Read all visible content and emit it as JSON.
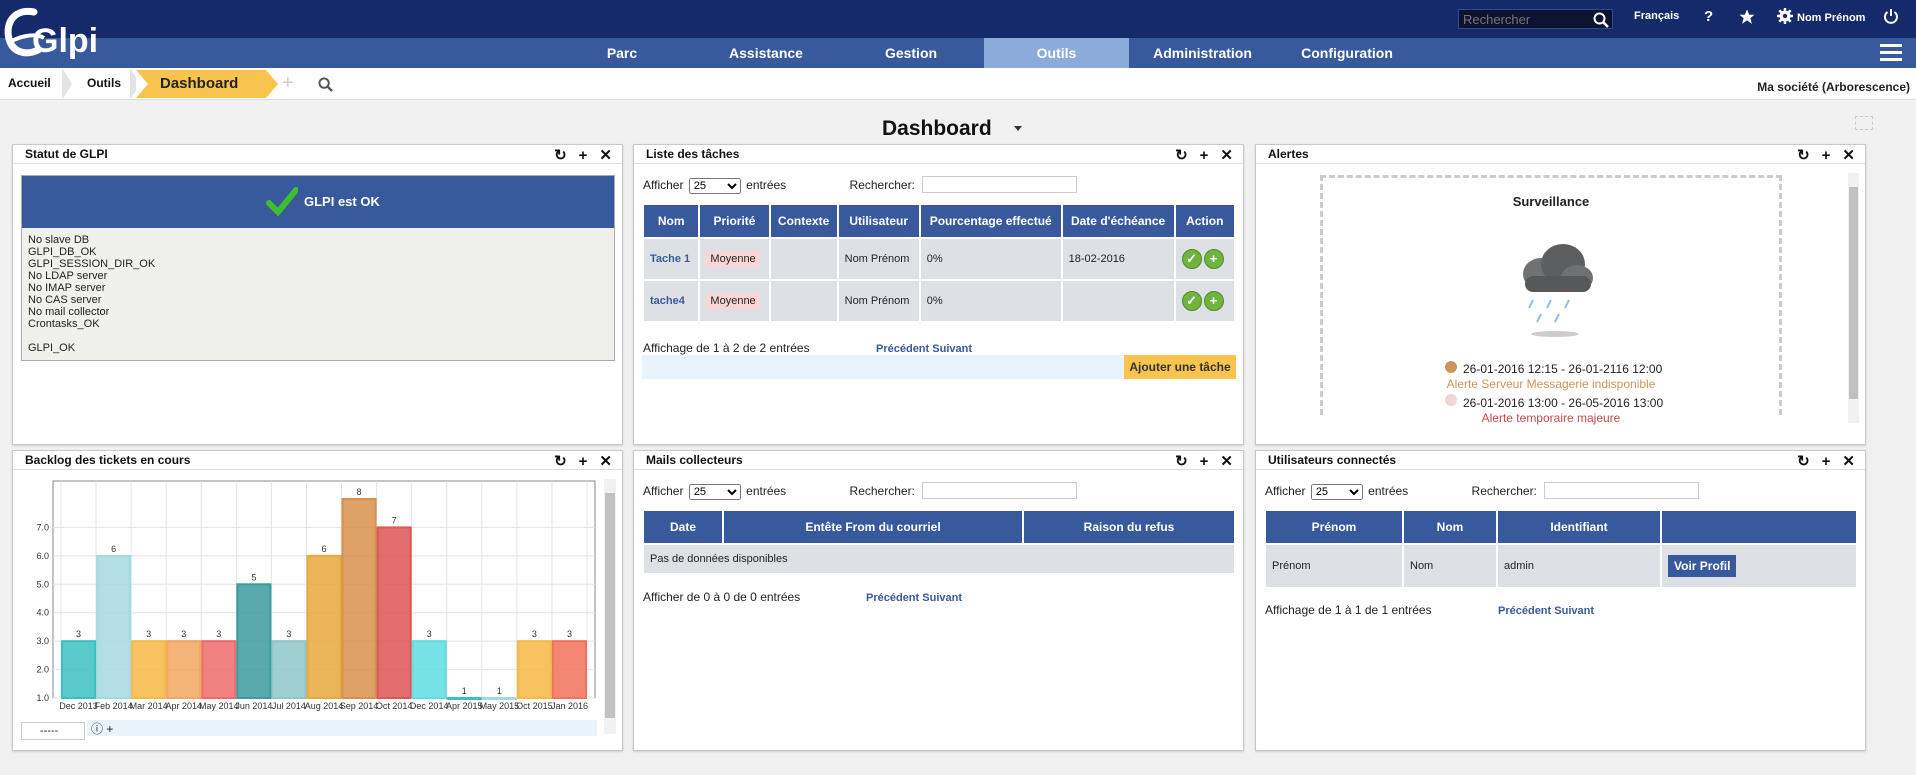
{
  "header": {
    "logo_text": "Glpi",
    "search_placeholder": "Rechercher",
    "language": "Français",
    "help_icon": "?",
    "user_name": "Nom Prénom"
  },
  "nav": {
    "items": [
      {
        "label": "Parc"
      },
      {
        "label": "Assistance"
      },
      {
        "label": "Gestion"
      },
      {
        "label": "Outils",
        "active": true
      },
      {
        "label": "Administration"
      },
      {
        "label": "Configuration"
      }
    ]
  },
  "breadcrumb": {
    "items": [
      "Accueil",
      "Outils"
    ],
    "active": "Dashboard",
    "add_icon": "+",
    "entity": "Ma société (Arborescence)"
  },
  "dashboard": {
    "title": "Dashboard"
  },
  "panel_icons": {
    "refresh": "↻",
    "add": "+",
    "close": "✕"
  },
  "status_panel": {
    "title": "Statut de GLPI",
    "banner": "GLPI est OK",
    "lines": [
      "No slave DB",
      "GLPI_DB_OK",
      "GLPI_SESSION_DIR_OK",
      "No LDAP server",
      "No IMAP server",
      "No CAS server",
      "No mail collector",
      "Crontasks_OK",
      "",
      "GLPI_OK"
    ]
  },
  "tasks_panel": {
    "title": "Liste des tâches",
    "show_label": "Afficher",
    "page_size": "25",
    "entries_label": "entrées",
    "search_label": "Rechercher:",
    "columns": [
      "Nom",
      "Priorité",
      "Contexte",
      "Utilisateur",
      "Pourcentage effectué",
      "Date d'échéance",
      "Action"
    ],
    "rows": [
      {
        "nom": "Tache 1",
        "priorite": "Moyenne",
        "contexte": "",
        "utilisateur": "Nom Prénom",
        "pourcentage": "0%",
        "echeance": "18-02-2016"
      },
      {
        "nom": "tache4",
        "priorite": "Moyenne",
        "contexte": "",
        "utilisateur": "Nom Prénom",
        "pourcentage": "0%",
        "echeance": ""
      }
    ],
    "summary": "Affichage de 1 à 2 de 2 entrées",
    "prev": "Précédent",
    "next": "Suivant",
    "add_button": "Ajouter une tâche"
  },
  "alerts_panel": {
    "title": "Alertes",
    "heading": "Surveillance",
    "alerts": [
      {
        "dates": "26-01-2016 12:15 - 26-01-2116 12:00",
        "label": "Alerte Serveur Messagerie indisponible",
        "color": "#c9955a"
      },
      {
        "dates": "26-01-2016 13:00 - 26-05-2016 13:00",
        "label": "Alerte temporaire majeure",
        "color": "#f0d6d6"
      }
    ]
  },
  "backlog_panel": {
    "title": "Backlog des tickets en cours",
    "select_value": "-----",
    "footer_icons": "ⓘ +"
  },
  "mails_panel": {
    "title": "Mails collecteurs",
    "show_label": "Afficher",
    "page_size": "25",
    "entries_label": "entrées",
    "search_label": "Rechercher:",
    "columns": [
      "Date",
      "Entête From du courriel",
      "Raison du refus"
    ],
    "empty": "Pas de données disponibles",
    "summary": "Afficher de 0 à 0 de 0 entrées",
    "prev": "Précédent",
    "next": "Suivant"
  },
  "users_panel": {
    "title": "Utilisateurs connectés",
    "show_label": "Afficher",
    "page_size": "25",
    "entries_label": "entrées",
    "search_label": "Rechercher:",
    "columns": [
      "Prénom",
      "Nom",
      "Identifiant",
      ""
    ],
    "rows": [
      {
        "prenom": "Prénom",
        "nom": "Nom",
        "identifiant": "admin",
        "action": "Voir Profil"
      }
    ],
    "summary": "Affichage de 1 à 1 de 1 entrées",
    "prev": "Précédent",
    "next": "Suivant"
  },
  "chart_data": {
    "type": "bar",
    "categories": [
      "Dec 2013",
      "Feb 2014",
      "Mar 2014",
      "Apr 2014",
      "May 2014",
      "Jun 2014",
      "Jul 2014",
      "Aug 2014",
      "Sep 2014",
      "Oct 2014",
      "Dec 2014",
      "Apr 2015",
      "May 2015",
      "Oct 2015",
      "Jan 2016"
    ],
    "values": [
      3,
      6,
      3,
      3,
      3,
      5,
      3,
      6,
      8,
      7,
      3,
      1,
      1,
      3,
      3
    ],
    "colors": [
      "#3cbfc0",
      "#a4d9e0",
      "#f5b844",
      "#f2a65f",
      "#ee6b6b",
      "#3b9b9d",
      "#8ec7c8",
      "#e8a93c",
      "#d8904d",
      "#dd5555",
      "#5fdde2",
      "#3cbfc0",
      "#a4d9e0",
      "#f5b844",
      "#f2725b"
    ],
    "ylim": [
      1,
      8
    ],
    "yticks": [
      "1.0",
      "2.0",
      "3.0",
      "4.0",
      "5.0",
      "6.0",
      "7.0"
    ],
    "grid": true
  }
}
